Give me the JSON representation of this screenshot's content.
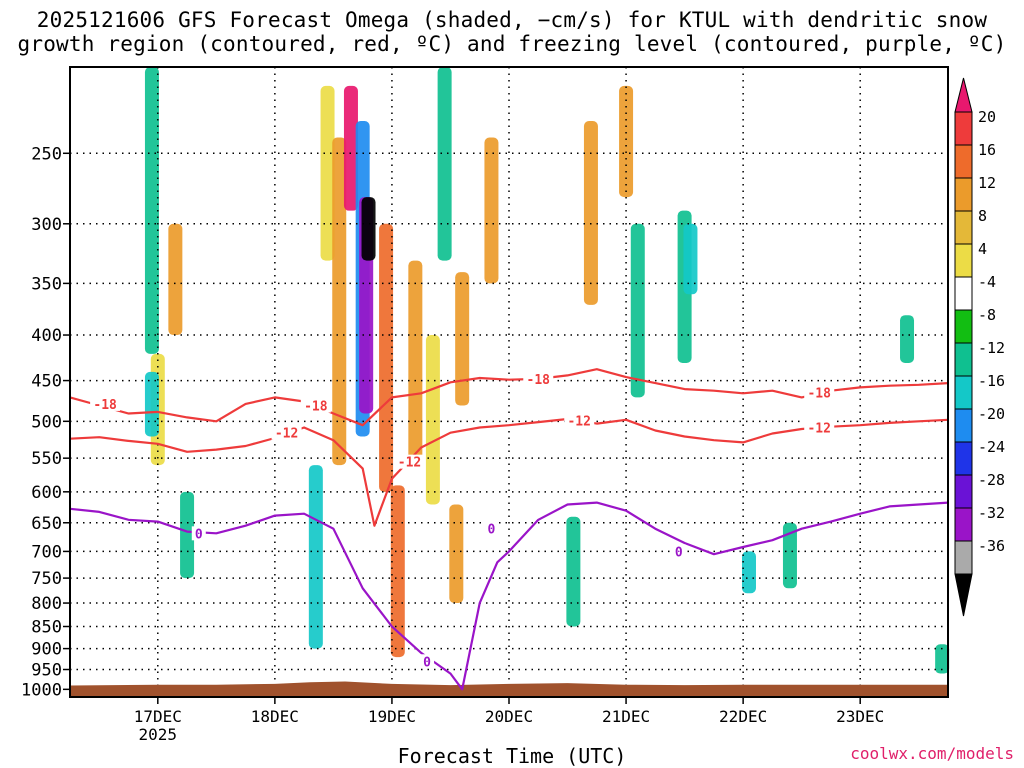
{
  "title": {
    "line1": "2025121606 GFS Forecast Omega (shaded, −cm/s) for KTUL with dendritic snow",
    "line2": "growth region (contoured, red, ºC) and freezing level (contoured, purple, ºC)"
  },
  "credit": "coolwx.com/models",
  "chart_data": {
    "type": "heatmap",
    "title": "2025121606 GFS Forecast Omega (shaded, −cm/s) for KTUL with dendritic snow growth region (contoured, red, ºC) and freezing level (contoured, purple, ºC)",
    "xlabel": "Forecast Time (UTC)",
    "ylabel": "",
    "x_tick_labels": [
      "17DEC",
      "18DEC",
      "19DEC",
      "20DEC",
      "21DEC",
      "22DEC",
      "23DEC"
    ],
    "x_tick_sublabel": "2025",
    "x_range_days": [
      16.25,
      23.75
    ],
    "y_tick_labels": [
      "250",
      "300",
      "350",
      "400",
      "450",
      "500",
      "550",
      "600",
      "650",
      "700",
      "750",
      "800",
      "850",
      "900",
      "950",
      "1000"
    ],
    "y_range": [
      200,
      1020
    ],
    "y_scale": "log-pressure",
    "colorbar_labels": [
      "20",
      "16",
      "12",
      "8",
      "4",
      "-4",
      "-8",
      "-12",
      "-16",
      "-20",
      "-24",
      "-28",
      "-32",
      "-36"
    ],
    "colorbar_colors": [
      "#e8186e",
      "#ee3b3b",
      "#ee6b2b",
      "#eb9b2b",
      "#e4b838",
      "#ecdc46",
      "#ffffff",
      "#12be12",
      "#0fc090",
      "#14c8c8",
      "#1e8cf0",
      "#1f34e8",
      "#6a12d6",
      "#9a14c8",
      "#aaaaaa",
      "#000000"
    ],
    "grid": true,
    "dgz_contours": [
      {
        "label": "-18",
        "color": "#ee3b3b",
        "points": [
          [
            16.25,
            470
          ],
          [
            16.5,
            480
          ],
          [
            16.75,
            490
          ],
          [
            17.0,
            488
          ],
          [
            17.25,
            495
          ],
          [
            17.5,
            500
          ],
          [
            17.75,
            478
          ],
          [
            18.0,
            470
          ],
          [
            18.25,
            475
          ],
          [
            18.5,
            490
          ],
          [
            18.75,
            505
          ],
          [
            19.0,
            470
          ],
          [
            19.25,
            465
          ],
          [
            19.5,
            452
          ],
          [
            19.75,
            447
          ],
          [
            20.0,
            449
          ],
          [
            20.25,
            448
          ],
          [
            20.5,
            444
          ],
          [
            20.75,
            437
          ],
          [
            21.0,
            446
          ],
          [
            21.25,
            453
          ],
          [
            21.5,
            460
          ],
          [
            21.75,
            462
          ],
          [
            22.0,
            465
          ],
          [
            22.25,
            462
          ],
          [
            22.5,
            470
          ],
          [
            22.75,
            462
          ],
          [
            23.0,
            458
          ],
          [
            23.25,
            456
          ],
          [
            23.5,
            455
          ],
          [
            23.75,
            453
          ]
        ]
      },
      {
        "label": "-12",
        "color": "#ee3b3b",
        "points": [
          [
            16.25,
            523
          ],
          [
            16.5,
            521
          ],
          [
            16.75,
            526
          ],
          [
            17.0,
            530
          ],
          [
            17.25,
            541
          ],
          [
            17.5,
            538
          ],
          [
            17.75,
            533
          ],
          [
            18.0,
            522
          ],
          [
            18.25,
            508
          ],
          [
            18.5,
            525
          ],
          [
            18.75,
            565
          ],
          [
            18.85,
            655
          ],
          [
            19.0,
            580
          ],
          [
            19.25,
            535
          ],
          [
            19.5,
            515
          ],
          [
            19.75,
            508
          ],
          [
            20.0,
            505
          ],
          [
            20.25,
            501
          ],
          [
            20.5,
            497
          ],
          [
            20.75,
            503
          ],
          [
            21.0,
            498
          ],
          [
            21.25,
            512
          ],
          [
            21.5,
            520
          ],
          [
            21.75,
            525
          ],
          [
            22.0,
            528
          ],
          [
            22.25,
            516
          ],
          [
            22.5,
            510
          ],
          [
            22.75,
            507
          ],
          [
            23.0,
            505
          ],
          [
            23.25,
            502
          ],
          [
            23.5,
            500
          ],
          [
            23.75,
            498
          ]
        ]
      },
      {
        "label": "0",
        "color": "#9a14c8",
        "points": [
          [
            16.25,
            627
          ],
          [
            16.5,
            632
          ],
          [
            16.75,
            645
          ],
          [
            17.0,
            648
          ],
          [
            17.25,
            665
          ],
          [
            17.5,
            668
          ],
          [
            17.75,
            655
          ],
          [
            18.0,
            638
          ],
          [
            18.25,
            635
          ],
          [
            18.5,
            660
          ],
          [
            18.75,
            770
          ],
          [
            19.0,
            850
          ],
          [
            19.25,
            910
          ],
          [
            19.5,
            960
          ],
          [
            19.6,
            1000
          ],
          [
            19.75,
            800
          ],
          [
            19.9,
            720
          ],
          [
            20.0,
            700
          ],
          [
            20.25,
            645
          ],
          [
            20.5,
            620
          ],
          [
            20.75,
            617
          ],
          [
            21.0,
            630
          ],
          [
            21.25,
            660
          ],
          [
            21.5,
            685
          ],
          [
            21.75,
            705
          ],
          [
            22.0,
            692
          ],
          [
            22.25,
            680
          ],
          [
            22.5,
            660
          ],
          [
            22.75,
            648
          ],
          [
            23.0,
            635
          ],
          [
            23.25,
            623
          ],
          [
            23.5,
            620
          ],
          [
            23.75,
            617
          ]
        ]
      }
    ],
    "omega_cells": [
      {
        "t": 18.45,
        "p1": 210,
        "p2": 330,
        "v": 4
      },
      {
        "t": 18.55,
        "p1": 240,
        "p2": 560,
        "v": 8
      },
      {
        "t": 18.65,
        "p1": 210,
        "p2": 290,
        "v": 20
      },
      {
        "t": 18.75,
        "p1": 230,
        "p2": 520,
        "v": -16
      },
      {
        "t": 18.78,
        "p1": 280,
        "p2": 490,
        "v": -28
      },
      {
        "t": 18.8,
        "p1": 280,
        "p2": 330,
        "v": -36
      },
      {
        "t": 18.95,
        "p1": 300,
        "p2": 600,
        "v": 12
      },
      {
        "t": 19.2,
        "p1": 330,
        "p2": 560,
        "v": 8
      },
      {
        "t": 19.35,
        "p1": 400,
        "p2": 620,
        "v": 4
      },
      {
        "t": 18.35,
        "p1": 560,
        "p2": 900,
        "v": -12
      },
      {
        "t": 19.05,
        "p1": 590,
        "p2": 920,
        "v": 12
      },
      {
        "t": 19.45,
        "p1": 200,
        "p2": 330,
        "v": -8
      },
      {
        "t": 19.85,
        "p1": 240,
        "p2": 350,
        "v": 8
      },
      {
        "t": 19.6,
        "p1": 340,
        "p2": 480,
        "v": 8
      },
      {
        "t": 17.0,
        "p1": 420,
        "p2": 560,
        "v": 4
      },
      {
        "t": 16.95,
        "p1": 440,
        "p2": 520,
        "v": -12
      },
      {
        "t": 17.15,
        "p1": 300,
        "p2": 400,
        "v": 8
      },
      {
        "t": 16.95,
        "p1": 190,
        "p2": 420,
        "v": -8
      },
      {
        "t": 20.7,
        "p1": 230,
        "p2": 370,
        "v": 8
      },
      {
        "t": 21.0,
        "p1": 210,
        "p2": 280,
        "v": 8
      },
      {
        "t": 21.1,
        "p1": 300,
        "p2": 470,
        "v": -8
      },
      {
        "t": 21.5,
        "p1": 290,
        "p2": 430,
        "v": -8
      },
      {
        "t": 21.55,
        "p1": 300,
        "p2": 360,
        "v": -12
      },
      {
        "t": 22.05,
        "p1": 700,
        "p2": 780,
        "v": -12
      },
      {
        "t": 22.4,
        "p1": 650,
        "p2": 770,
        "v": -8
      },
      {
        "t": 23.4,
        "p1": 380,
        "p2": 430,
        "v": -8
      },
      {
        "t": 23.7,
        "p1": 890,
        "p2": 960,
        "v": -8
      },
      {
        "t": 20.55,
        "p1": 640,
        "p2": 850,
        "v": -8
      },
      {
        "t": 17.25,
        "p1": 600,
        "p2": 750,
        "v": -8
      },
      {
        "t": 19.55,
        "p1": 620,
        "p2": 800,
        "v": 8
      }
    ],
    "terrain": {
      "color": "#a0522d",
      "points": [
        [
          16.25,
          990
        ],
        [
          17.0,
          988
        ],
        [
          17.5,
          988
        ],
        [
          18.0,
          986
        ],
        [
          18.3,
          982
        ],
        [
          18.6,
          980
        ],
        [
          19.0,
          986
        ],
        [
          19.5,
          989
        ],
        [
          20.0,
          986
        ],
        [
          20.5,
          984
        ],
        [
          21.0,
          988
        ],
        [
          21.5,
          989
        ],
        [
          22.0,
          988
        ],
        [
          22.5,
          988
        ],
        [
          23.0,
          988
        ],
        [
          23.75,
          988
        ]
      ]
    },
    "contour_label_positions": [
      {
        "label": "-18",
        "t": 16.55,
        "p": 478,
        "color": "#ee3b3b"
      },
      {
        "label": "-18",
        "t": 18.35,
        "p": 480,
        "color": "#ee3b3b"
      },
      {
        "label": "-18",
        "t": 20.25,
        "p": 448,
        "color": "#ee3b3b"
      },
      {
        "label": "-18",
        "t": 22.65,
        "p": 464,
        "color": "#ee3b3b"
      },
      {
        "label": "-12",
        "t": 18.1,
        "p": 515,
        "color": "#ee3b3b"
      },
      {
        "label": "-12",
        "t": 19.15,
        "p": 555,
        "color": "#ee3b3b"
      },
      {
        "label": "-12",
        "t": 20.6,
        "p": 499,
        "color": "#ee3b3b"
      },
      {
        "label": "-12",
        "t": 22.65,
        "p": 508,
        "color": "#ee3b3b"
      },
      {
        "label": "0",
        "t": 17.35,
        "p": 668,
        "color": "#9a14c8"
      },
      {
        "label": "0",
        "t": 19.3,
        "p": 930,
        "color": "#9a14c8"
      },
      {
        "label": "0",
        "t": 19.85,
        "p": 660,
        "color": "#9a14c8"
      },
      {
        "label": "0",
        "t": 21.45,
        "p": 700,
        "color": "#9a14c8"
      }
    ]
  }
}
